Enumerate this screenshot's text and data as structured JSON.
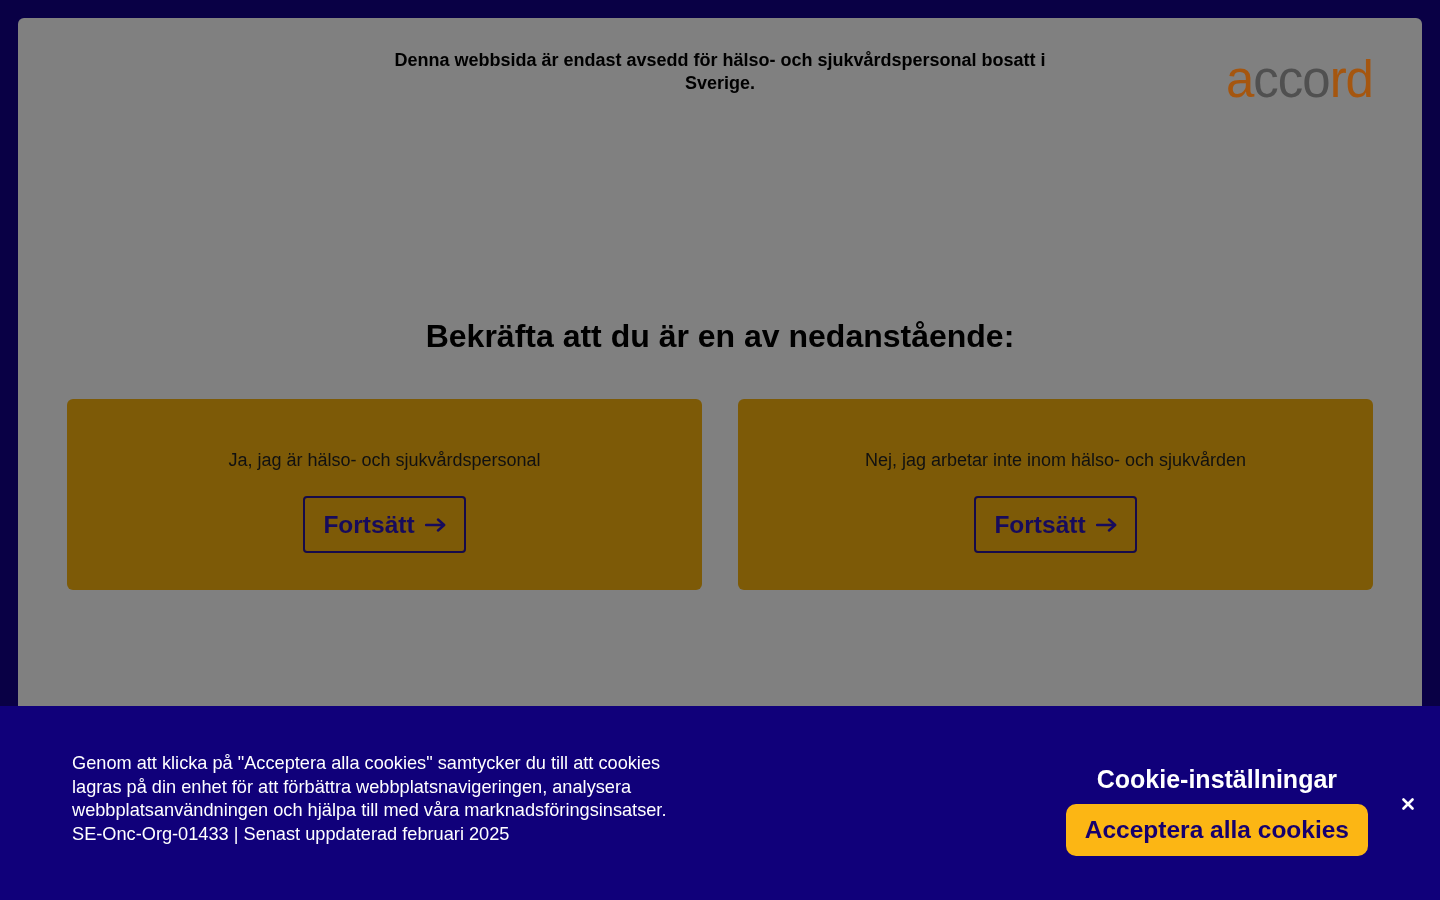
{
  "notice": {
    "text": "Denna webbsida är endast avsedd för hälso- och sjukvårdspersonal bosatt i Sverige."
  },
  "logo": {
    "parts": [
      {
        "text": "a",
        "color": "#a5560f"
      },
      {
        "text": "cco",
        "color": "#505050"
      },
      {
        "text": "rd",
        "color": "#a5560f"
      }
    ]
  },
  "heading": "Bekräfta att du är en av nedanstående:",
  "options": [
    {
      "label": "Ja, jag är hälso- och sjukvårdspersonal",
      "button": "Fortsätt"
    },
    {
      "label": "Nej, jag arbetar inte inom hälso- och sjukvården",
      "button": "Fortsätt"
    }
  ],
  "cookie_banner": {
    "text": "Genom att klicka på \"Acceptera alla cookies\" samtycker du till att cookies lagras på din enhet för att förbättra webbplatsnavigeringen, analysera webbplatsanvändningen och hjälpa till med våra marknadsföringsinsatser. SE-Onc-Org-01433 | Senast uppdaterad februari 2025",
    "settings_link": "Cookie-inställningar",
    "accept_button": "Acceptera alla cookies"
  }
}
